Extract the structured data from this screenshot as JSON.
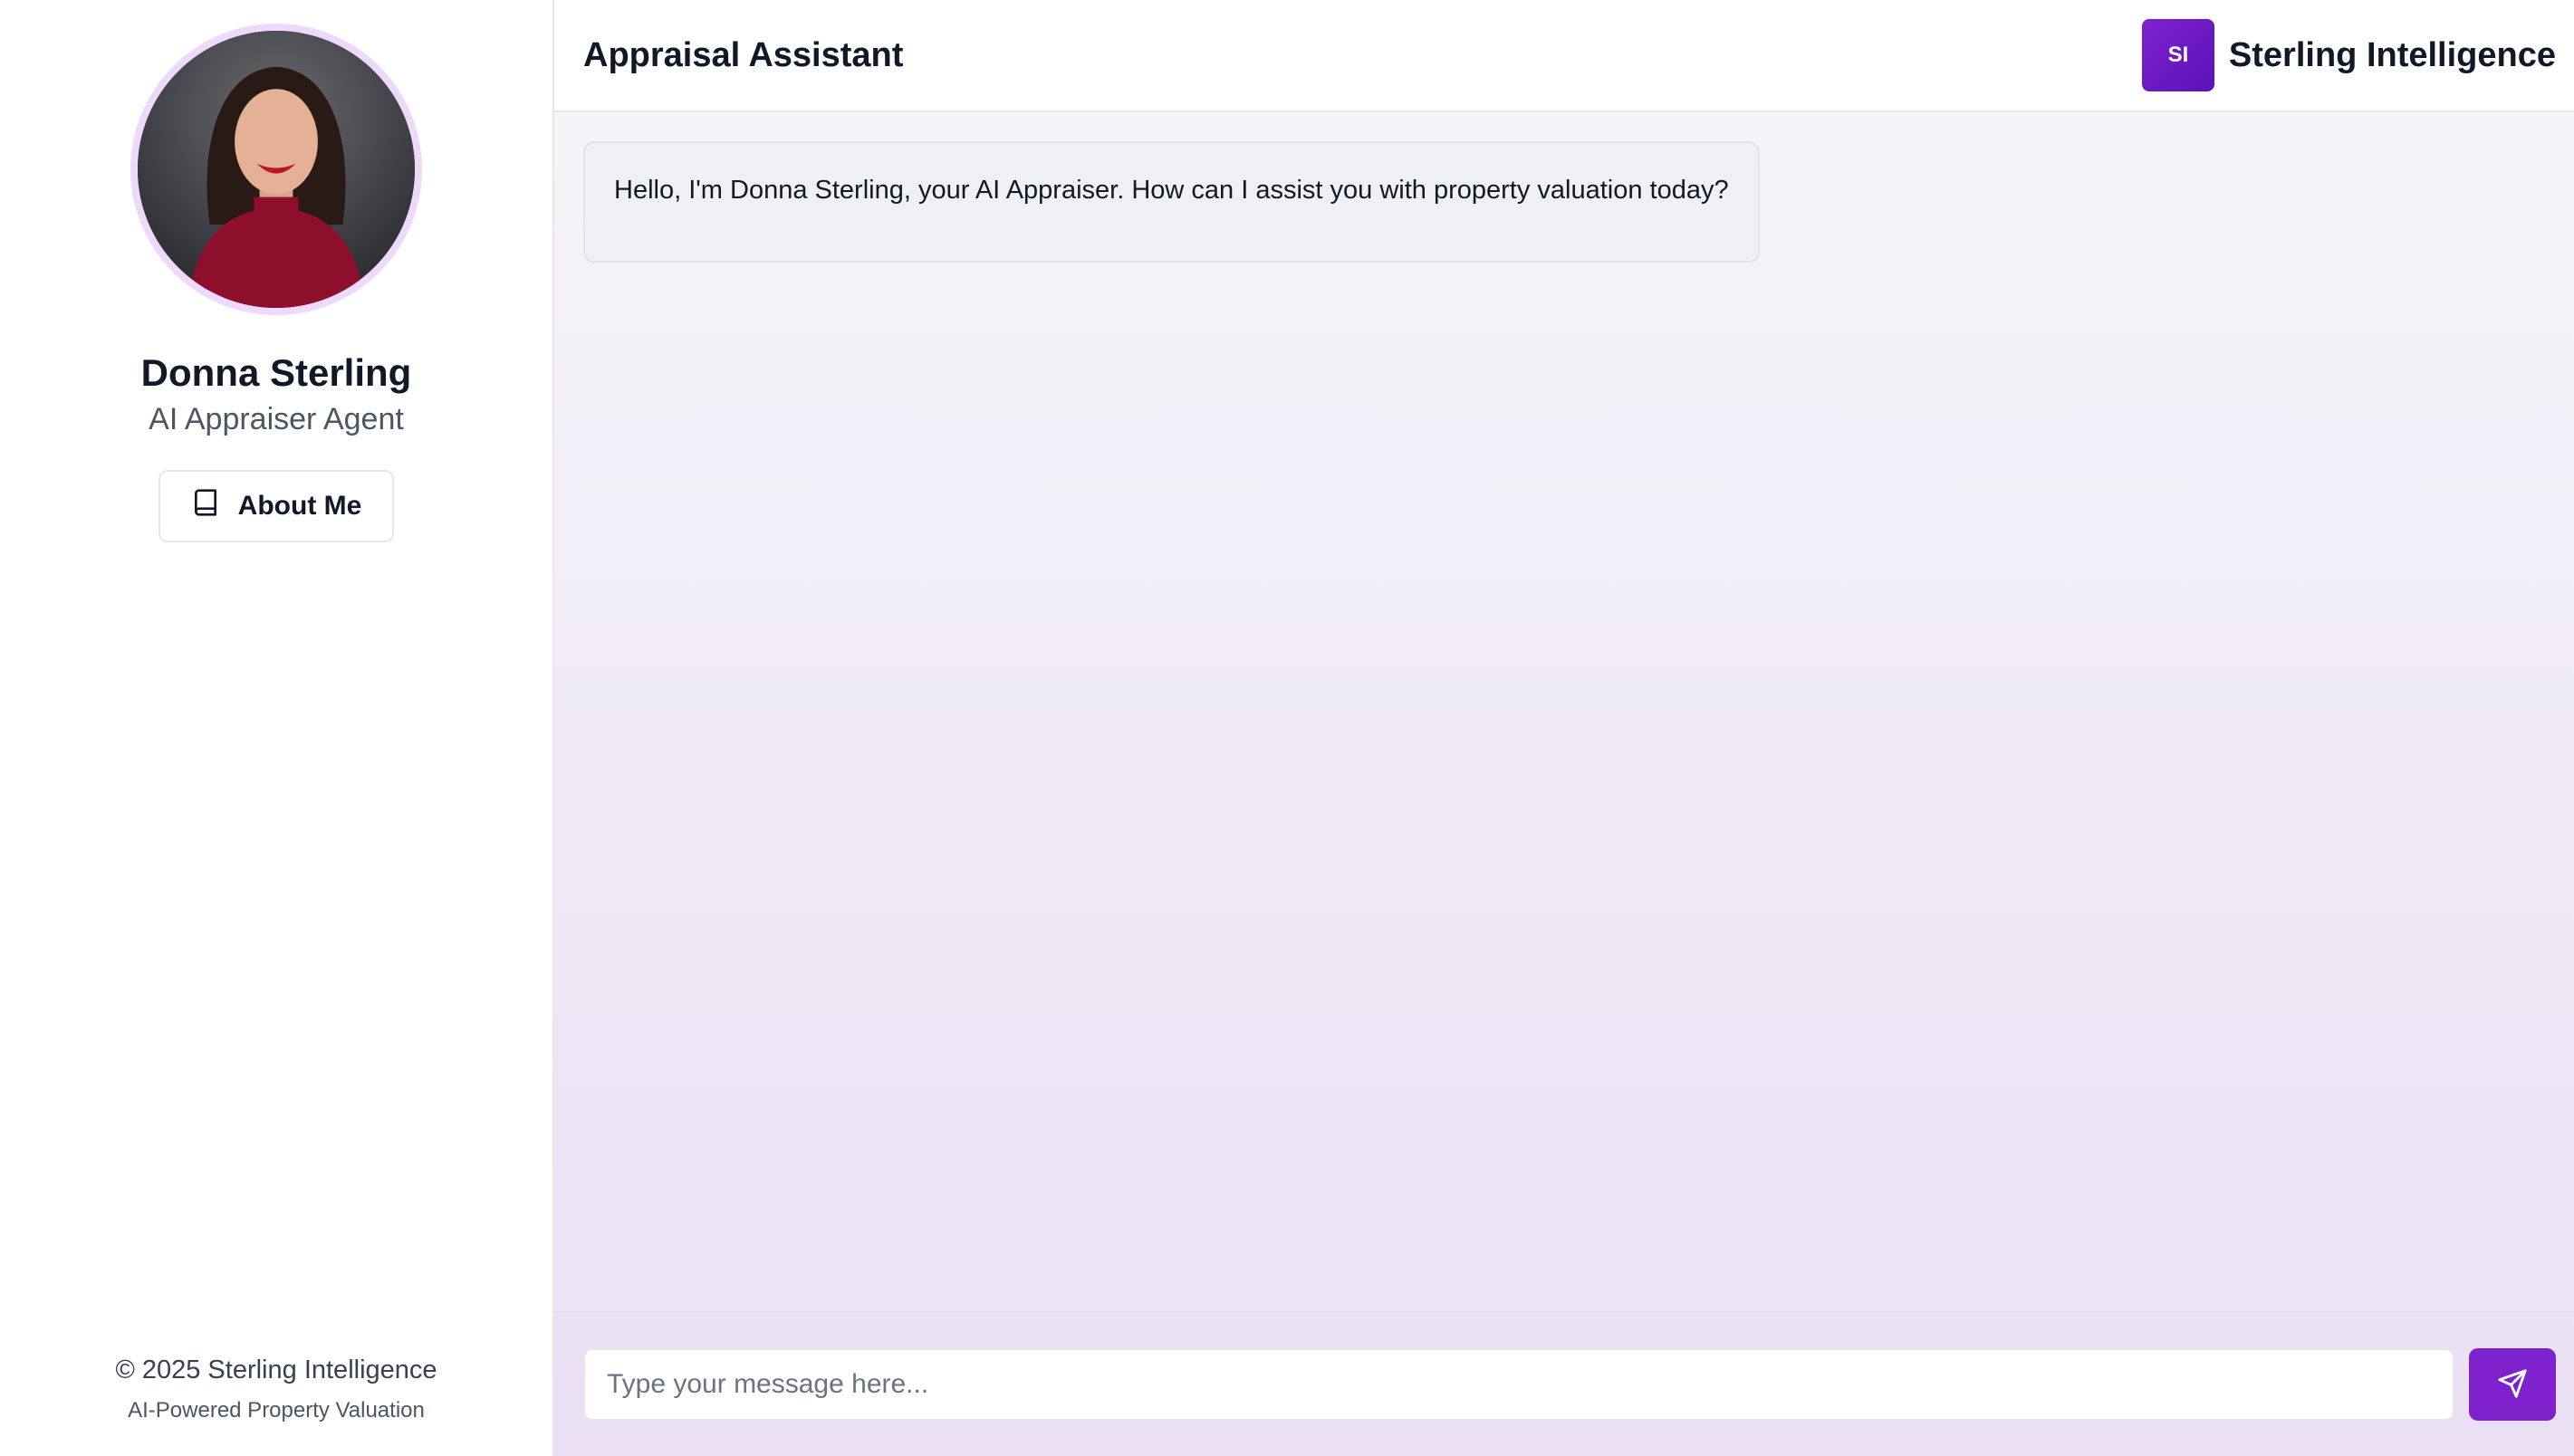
{
  "sidebar": {
    "agent_name": "Donna Sterling",
    "agent_role": "AI Appraiser Agent",
    "about_button": {
      "label": "About Me",
      "icon": "book-icon"
    },
    "footer": {
      "copyright": "© 2025 Sterling Intelligence",
      "tagline": "AI-Powered Property Valuation"
    }
  },
  "header": {
    "title": "Appraisal Assistant",
    "brand_initials": "SI",
    "brand_name": "Sterling Intelligence"
  },
  "chat": {
    "messages": [
      {
        "sender": "assistant",
        "text": "Hello, I'm Donna Sterling, your AI Appraiser. How can I assist you with property valuation today?"
      }
    ]
  },
  "composer": {
    "placeholder": "Type your message here...",
    "value": "",
    "send_icon": "send-icon"
  },
  "colors": {
    "accent": "#7e22ce",
    "avatar_ring": "#efd9fb",
    "bubble_bg": "#eff0f4"
  }
}
